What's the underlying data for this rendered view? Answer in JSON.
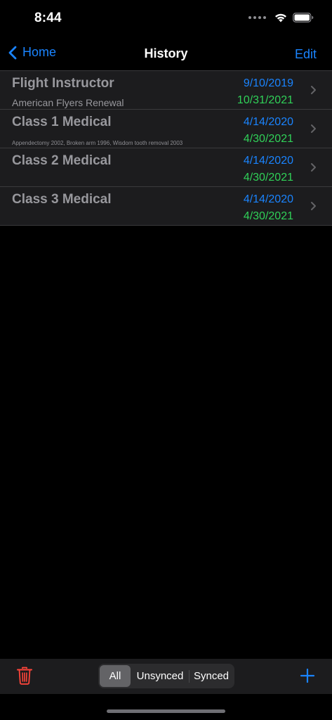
{
  "status_bar": {
    "time": "8:44"
  },
  "nav": {
    "back_label": "Home",
    "title": "History",
    "edit_label": "Edit"
  },
  "rows": [
    {
      "title": "Flight Instructor",
      "subtitle": "American Flyers Renewal",
      "date_start": "9/10/2019",
      "date_end": "10/31/2021"
    },
    {
      "title": "Class 1 Medical",
      "subtitle": "Appendectomy 2002, Broken arm 1996, Wisdom tooth removal 2003",
      "date_start": "4/14/2020",
      "date_end": "4/30/2021"
    },
    {
      "title": "Class 2 Medical",
      "subtitle": "",
      "date_start": "4/14/2020",
      "date_end": "4/30/2021"
    },
    {
      "title": "Class 3 Medical",
      "subtitle": "",
      "date_start": "4/14/2020",
      "date_end": "4/30/2021"
    }
  ],
  "toolbar": {
    "segments": [
      "All",
      "Unsynced",
      "Synced"
    ],
    "selected_segment": "All"
  },
  "colors": {
    "accent": "#1a84ff",
    "date_end": "#30d158",
    "delete": "#ff453a",
    "background": "#000000",
    "row_background": "#1c1c1e"
  },
  "icons": {
    "back": "chevron-left-icon",
    "row_disclosure": "chevron-right-icon",
    "delete": "trash-icon",
    "add": "plus-icon",
    "signal": "cellular-signal-icon",
    "wifi": "wifi-icon",
    "battery": "battery-icon"
  }
}
